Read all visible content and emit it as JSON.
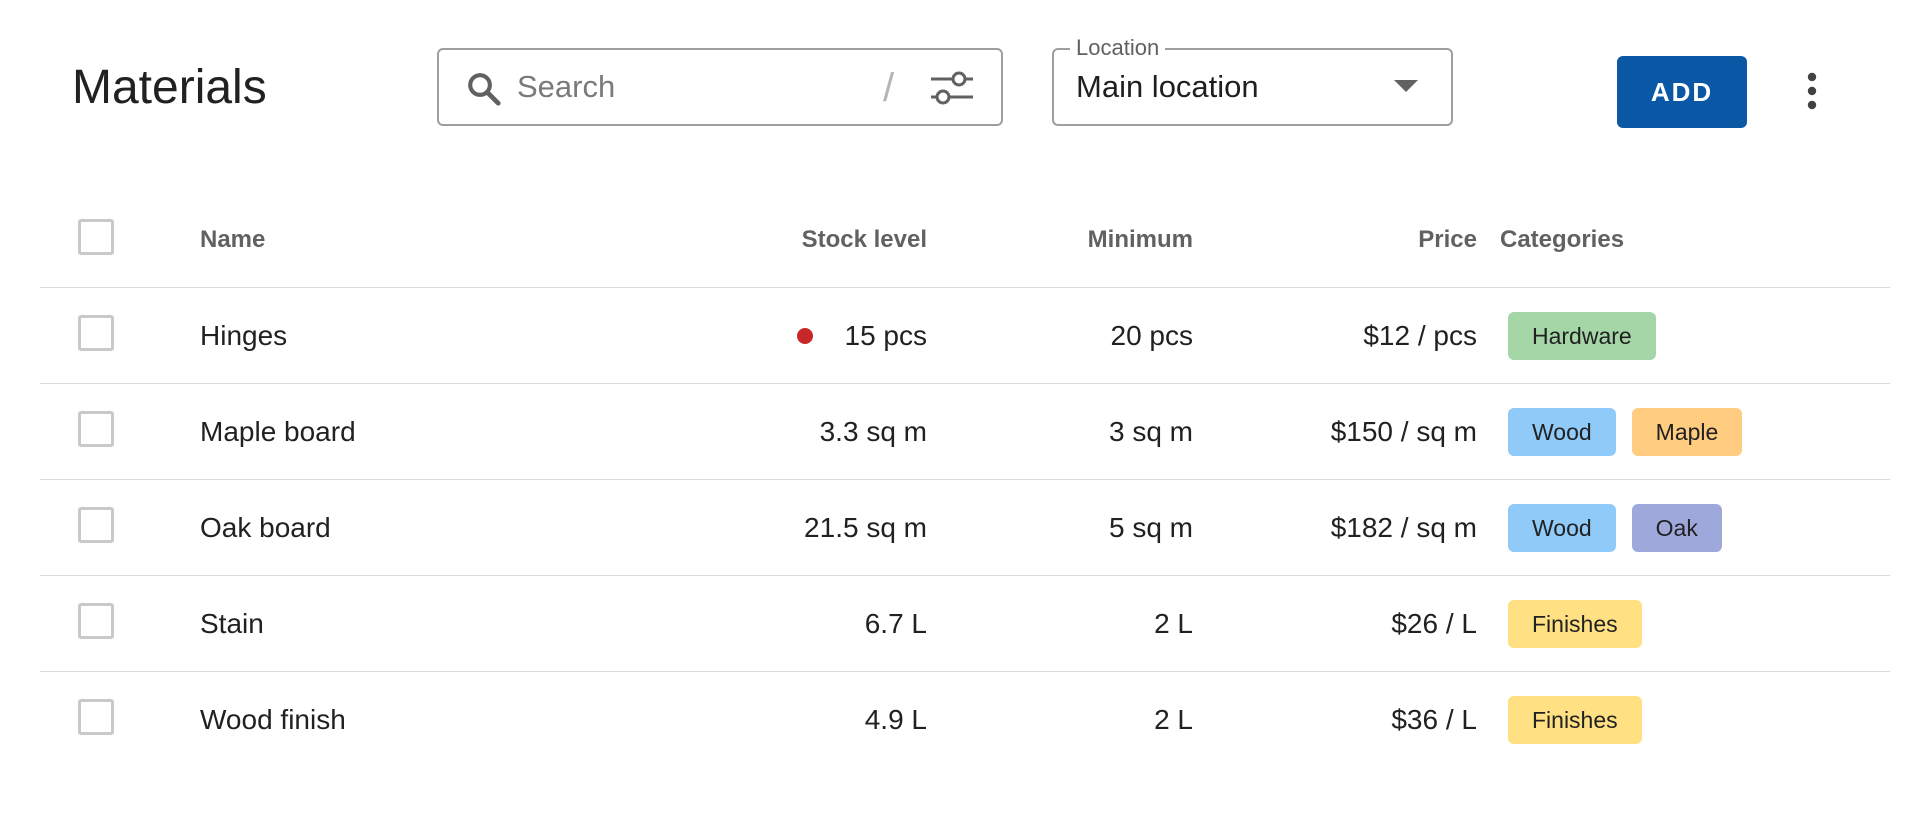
{
  "header": {
    "title": "Materials",
    "search": {
      "placeholder": "Search",
      "value": "",
      "shortcut_hint": "/"
    },
    "location": {
      "label": "Location",
      "selected": "Main location"
    },
    "add_label": "ADD"
  },
  "table": {
    "columns": {
      "name": "Name",
      "stock": "Stock level",
      "minimum": "Minimum",
      "price": "Price",
      "categories": "Categories"
    },
    "rows": [
      {
        "name": "Hinges",
        "stock": "15 pcs",
        "low_stock": true,
        "minimum": "20 pcs",
        "price": "$12 / pcs",
        "categories": [
          {
            "label": "Hardware",
            "color": "#a5d6a7"
          }
        ]
      },
      {
        "name": "Maple board",
        "stock": "3.3 sq m",
        "low_stock": false,
        "minimum": "3 sq m",
        "price": "$150 / sq m",
        "categories": [
          {
            "label": "Wood",
            "color": "#90caf9"
          },
          {
            "label": "Maple",
            "color": "#ffcc80"
          }
        ]
      },
      {
        "name": "Oak board",
        "stock": "21.5 sq m",
        "low_stock": false,
        "minimum": "5 sq m",
        "price": "$182 / sq m",
        "categories": [
          {
            "label": "Wood",
            "color": "#90caf9"
          },
          {
            "label": "Oak",
            "color": "#9fa8da"
          }
        ]
      },
      {
        "name": "Stain",
        "stock": "6.7 L",
        "low_stock": false,
        "minimum": "2 L",
        "price": "$26 / L",
        "categories": [
          {
            "label": "Finishes",
            "color": "#ffe082"
          }
        ]
      },
      {
        "name": "Wood finish",
        "stock": "4.9 L",
        "low_stock": false,
        "minimum": "2 L",
        "price": "$36 / L",
        "categories": [
          {
            "label": "Finishes",
            "color": "#ffe082"
          }
        ]
      }
    ]
  },
  "icons": {
    "search": "search-icon",
    "filter": "sliders-icon",
    "dropdown": "caret-down-icon",
    "more": "more-vertical-icon",
    "low_stock": "red-dot-indicator"
  },
  "colors": {
    "primary": "#0a58a5",
    "low_stock": "#c62828"
  }
}
